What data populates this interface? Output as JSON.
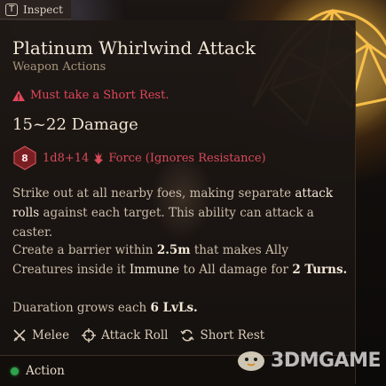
{
  "inspect": {
    "key": "T",
    "label": "Inspect"
  },
  "spell": {
    "name": "Platinum Whirlwind Attack",
    "category": "Weapon Actions",
    "requirement": "Must take a Short Rest.",
    "damage": "15~22 Damage",
    "dice": {
      "value": "8",
      "roll": "1d8+14",
      "type": "Force (Ignores Resistance)"
    },
    "description_1": {
      "a": "Strike out at all nearby foes, making separate ",
      "b": "attack rolls",
      "c": " against each target. This ability can attack a caster."
    },
    "description_2": {
      "a": "Create a barrier within ",
      "b": "2.5m",
      "c": " that makes Ally Creatures inside it ",
      "d": "Immune",
      "e": " to All damage for ",
      "f": "2 Turns."
    },
    "description_3": {
      "a": "Duaration grows each ",
      "b": "6 LvLs."
    },
    "tags": [
      {
        "icon": "crossed-swords-icon",
        "label": "Melee"
      },
      {
        "icon": "crosshair-icon",
        "label": "Attack Roll"
      },
      {
        "icon": "rest-cycle-icon",
        "label": "Short Rest"
      }
    ]
  },
  "footer": {
    "label": "Action",
    "color": "#2fa34b"
  },
  "colors": {
    "warning": "#e0465a",
    "damage_type": "#d94a5a",
    "accent_glow": "#ffbe3c"
  },
  "watermark": {
    "text": "3DMGAME"
  }
}
